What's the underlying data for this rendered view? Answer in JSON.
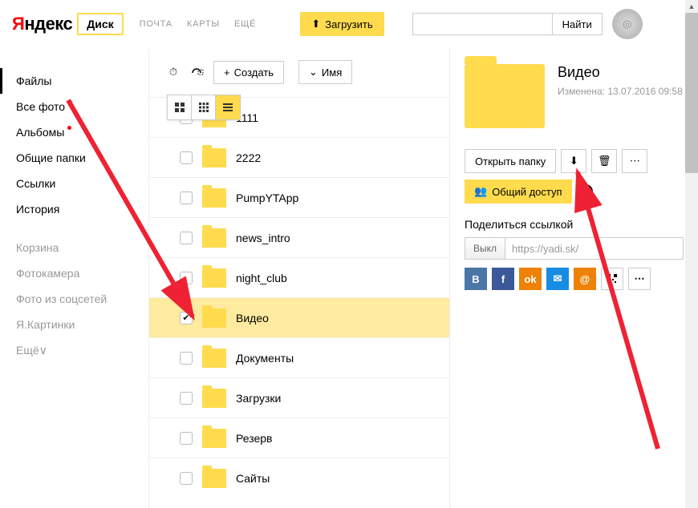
{
  "header": {
    "logo1": "Я",
    "logo2": "ндекс",
    "disk": "Диск",
    "nav": [
      "ПОЧТА",
      "КАРТЫ",
      "ЕЩЁ"
    ],
    "upload": "Загрузить",
    "search_placeholder": "",
    "search_btn": "Найти"
  },
  "sidebar": {
    "items": [
      {
        "label": "Файлы",
        "active": true
      },
      {
        "label": "Все фото",
        "dot": true
      },
      {
        "label": "Альбомы",
        "dot": true
      },
      {
        "label": "Общие папки"
      },
      {
        "label": "Ссылки"
      },
      {
        "label": "История"
      }
    ],
    "muted": [
      {
        "label": "Корзина"
      },
      {
        "label": "Фотокамера"
      },
      {
        "label": "Фото из соцсетей"
      },
      {
        "label": "Я.Картинки"
      },
      {
        "label": "Ещё∨"
      }
    ]
  },
  "toolbar": {
    "create": "Создать",
    "sort": "Имя"
  },
  "files": [
    {
      "name": "1111"
    },
    {
      "name": "2222"
    },
    {
      "name": "PumpYTApp"
    },
    {
      "name": "news_intro"
    },
    {
      "name": "night_club"
    },
    {
      "name": "Видео",
      "selected": true
    },
    {
      "name": "Документы"
    },
    {
      "name": "Загрузки"
    },
    {
      "name": "Резерв"
    },
    {
      "name": "Сайты"
    }
  ],
  "details": {
    "title": "Видео",
    "modified_label": "Изменена:",
    "modified_value": "13.07.2016 09:58",
    "open": "Открыть папку",
    "share": "Общий доступ",
    "link_section": "Поделиться ссылкой",
    "toggle_off": "Выкл",
    "link_value": "https://yadi.sk/"
  }
}
